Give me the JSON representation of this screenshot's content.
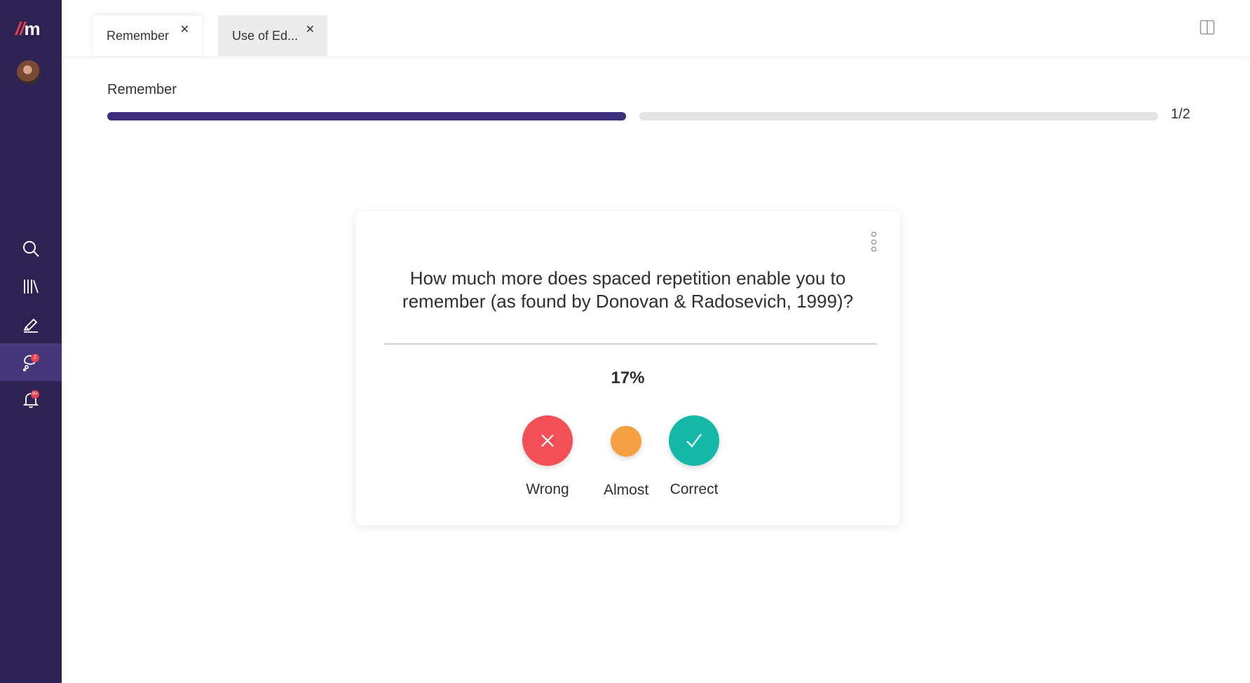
{
  "app": {
    "logo": {
      "slashes": "//",
      "letter": "m"
    },
    "accent_color": "#3d2e7c",
    "sidebar_color": "#2e2252"
  },
  "sidebar": {
    "items": [
      {
        "icon": "search-icon"
      },
      {
        "icon": "library-icon"
      },
      {
        "icon": "highlighter-icon"
      },
      {
        "icon": "flashcard-review-icon",
        "active": true,
        "badge": "2"
      },
      {
        "icon": "bell-icon",
        "badge": "9+"
      }
    ]
  },
  "tabs": [
    {
      "label": "Remember",
      "active": true
    },
    {
      "label": "Use of Ed...",
      "active": false
    }
  ],
  "session": {
    "title": "Remember",
    "progress_label": "1/2",
    "segments": [
      {
        "fill": 1.0
      },
      {
        "fill": 0.0
      }
    ]
  },
  "card": {
    "question": "How much more does spaced repetition enable you to remember (as found by Donovan & Radosevich, 1999)?",
    "answer": "17%",
    "ratings": [
      {
        "label": "Wrong",
        "color": "#f25056",
        "icon": "x-icon"
      },
      {
        "label": "Almost",
        "color": "#f5a042"
      },
      {
        "label": "Correct",
        "color": "#14b8a8",
        "icon": "checkmark-icon"
      }
    ]
  }
}
